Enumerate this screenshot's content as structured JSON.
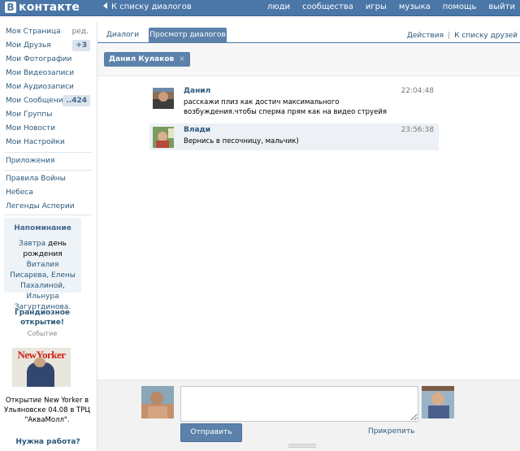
{
  "header": {
    "logo_letter": "В",
    "logo_text": "контакте",
    "back_link": "К списку диалогов",
    "nav": [
      "люди",
      "сообщества",
      "игры",
      "музыка",
      "помощь",
      "выйти"
    ]
  },
  "sidebar": {
    "items": [
      {
        "label": "Моя Страница",
        "extra": "ред."
      },
      {
        "label": "Мои Друзья",
        "badge": "+3"
      },
      {
        "label": "Мои Фотографии"
      },
      {
        "label": "Мои Видеозаписи"
      },
      {
        "label": "Мои Аудиозаписи"
      },
      {
        "label": "Мои Сообщения",
        "badge": "..424"
      },
      {
        "label": "Мои Группы"
      },
      {
        "label": "Мои Новости"
      },
      {
        "label": "Мои Настройки"
      }
    ],
    "apps": "Приложения",
    "apps_list": [
      "Правила Войны",
      "Небеса",
      "Легенды Асперии"
    ],
    "reminder": {
      "title": "Напоминание",
      "text_1": "Завтра",
      "text_2": "день рождения",
      "people_1": "Виталия Писарева, Елены Пахалиной, Ильнура Загуртдинова."
    },
    "ad": {
      "title": "Грандиозное открытие!",
      "subtitle": "Событие",
      "brand": "NewYorker",
      "text": "Открытие New Yorker в Ульяновске 04.08 в ТРЦ \"АкваМолл\".",
      "next_title": "Нужна работа?"
    }
  },
  "main": {
    "tabs": [
      "Диалоги",
      "Просмотр диалогов"
    ],
    "actions": "Действия",
    "to_friends": "К списку друзей",
    "chip": "Данил Кулаков",
    "chip_close": "×",
    "messages": [
      {
        "name": "Данил",
        "time": "22:04:48",
        "text": "расскажи плиз как достич максимального возбуждения.чтобы сперма прям как на видео струейя"
      },
      {
        "name": "Влади",
        "time": "23:56:38",
        "text": "Вернись в песочницу, мальчик)"
      }
    ],
    "composer": {
      "send": "Отправить",
      "attach": "Прикрепить",
      "input_value": ""
    }
  },
  "colors": {
    "brand": "#4a76a8",
    "link": "#2b587a",
    "button": "#5c82ab",
    "highlight": "#edf1f5"
  }
}
